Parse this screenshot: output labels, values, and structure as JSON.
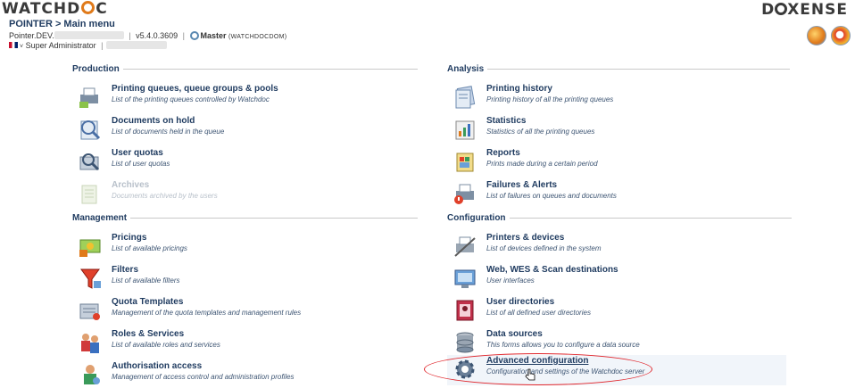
{
  "header": {
    "logo_left": [
      "WATCHD",
      "C"
    ],
    "logo_right": [
      "D",
      "XENSE"
    ],
    "breadcrumb": "POINTER > Main menu",
    "server_prefix": "Pointer.DEV.",
    "version": "v5.4.0.3609",
    "master_label": "Master",
    "master_domain": "(WATCHDOCDOM)",
    "user_role": "Super Administrator"
  },
  "sections": {
    "production": {
      "title": "Production",
      "items": [
        {
          "title": "Printing queues, queue groups & pools",
          "desc": "List of the printing queues controlled by Watchdoc",
          "icon": "printer-queue-icon"
        },
        {
          "title": "Documents on hold",
          "desc": "List of documents held in the queue",
          "icon": "documents-on-hold-icon"
        },
        {
          "title": "User quotas",
          "desc": "List of user quotas",
          "icon": "user-quotas-icon"
        },
        {
          "title": "Archives",
          "desc": "Documents archived by the users",
          "icon": "archives-icon"
        }
      ]
    },
    "management": {
      "title": "Management",
      "items": [
        {
          "title": "Pricings",
          "desc": "List of available pricings",
          "icon": "pricings-icon"
        },
        {
          "title": "Filters",
          "desc": "List of available filters",
          "icon": "filters-icon"
        },
        {
          "title": "Quota Templates",
          "desc": "Management of the quota templates and management rules",
          "icon": "quota-templates-icon"
        },
        {
          "title": "Roles & Services",
          "desc": "List of available roles and services",
          "icon": "roles-services-icon"
        },
        {
          "title": "Authorisation access",
          "desc": "Management of access control and administration profiles",
          "icon": "authorisation-icon"
        }
      ]
    },
    "analysis": {
      "title": "Analysis",
      "items": [
        {
          "title": "Printing history",
          "desc": "Printing history of all the printing queues",
          "icon": "printing-history-icon"
        },
        {
          "title": "Statistics",
          "desc": "Statistics of all the printing queues",
          "icon": "statistics-icon"
        },
        {
          "title": "Reports",
          "desc": "Prints made during a certain period",
          "icon": "reports-icon"
        },
        {
          "title": "Failures & Alerts",
          "desc": "List of failures on queues and documents",
          "icon": "failures-alerts-icon"
        }
      ]
    },
    "configuration": {
      "title": "Configuration",
      "items": [
        {
          "title": "Printers & devices",
          "desc": "List of devices defined in the system",
          "icon": "printers-devices-icon"
        },
        {
          "title": "Web, WES & Scan destinations",
          "desc": "User interfaces",
          "icon": "web-wes-scan-icon"
        },
        {
          "title": "User directories",
          "desc": "List of all defined user directories",
          "icon": "user-directories-icon"
        },
        {
          "title": "Data sources",
          "desc": "This forms allows you to configure a data source",
          "icon": "data-sources-icon"
        },
        {
          "title": "Advanced configuration",
          "desc": "Configuration and settings of the Watchdoc server",
          "icon": "gear-icon"
        }
      ]
    }
  },
  "colors": {
    "title": "#1e3a5f",
    "accent_orange": "#e07a1a",
    "annotation_red": "#e0262c",
    "disabled": "#b8c0ca"
  }
}
